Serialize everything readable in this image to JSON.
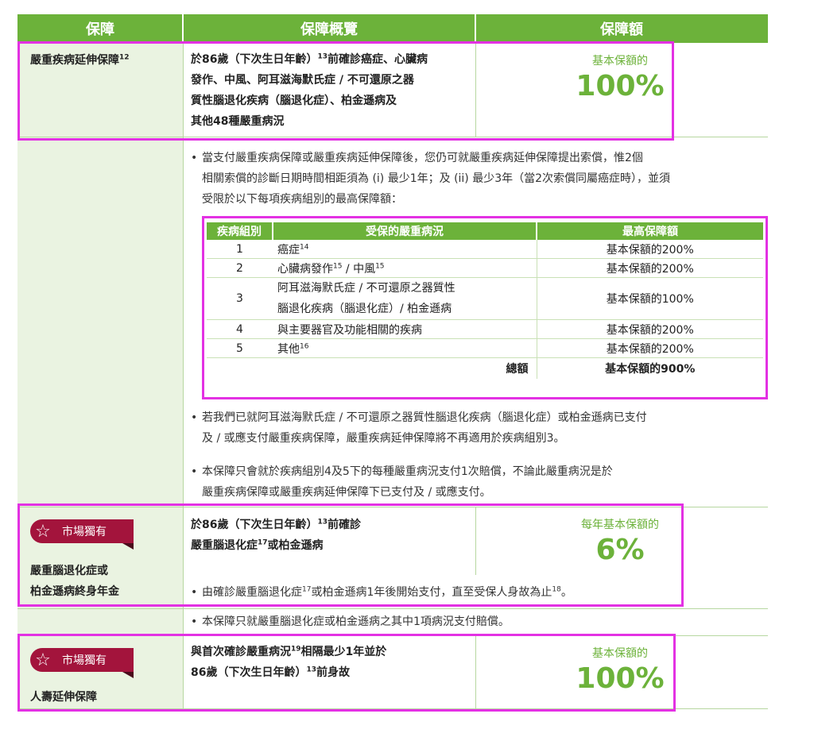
{
  "header": {
    "col1": "保障",
    "col2": "保障概覽",
    "col3": "保障額"
  },
  "row1": {
    "name": "嚴重疾病延伸保障",
    "name_sup": "12",
    "desc_lines": [
      {
        "pre": "於86歲（下次生日年齡）",
        "sup": "13",
        "post": "前確診癌症、心臟病"
      },
      {
        "pre": "發作、中風、阿耳滋海默氏症 / 不可還原之器",
        "sup": "",
        "post": ""
      },
      {
        "pre": "質性腦退化疾病（腦退化症）、柏金遜病及",
        "sup": "",
        "post": ""
      },
      {
        "pre": "其他48種嚴重病況",
        "sup": "",
        "post": ""
      }
    ],
    "amount_label": "基本保額的",
    "amount_value": "100%"
  },
  "bullets1": {
    "b1": [
      "當支付嚴重疾病保障或嚴重疾病延伸保障後，您仍可就嚴重疾病延伸保障提出索償，惟2個",
      "相關索償的診斷日期時間相距須為 (i) 最少1年；及 (ii) 最少3年（當2次索償同屬癌症時），並須",
      "受限於以下每項疾病組別的最高保障額："
    ]
  },
  "inner_table": {
    "headers": [
      "疾病組別",
      "受保的嚴重病況",
      "最高保障額"
    ],
    "rows": [
      {
        "group": "1",
        "cond_lines": [
          {
            "t": "癌症",
            "s": "14"
          }
        ],
        "max": "基本保額的200%"
      },
      {
        "group": "2",
        "cond_lines": [
          {
            "t": "心臟病發作",
            "s": "15"
          },
          {
            "t": " / 中風",
            "s": "15"
          }
        ],
        "max": "基本保額的200%"
      },
      {
        "group": "3",
        "cond_lines": [
          {
            "t": "阿耳滋海默氏症 / 不可還原之器質性",
            "s": ""
          }
        ],
        "cond2": "腦退化疾病（腦退化症）/ 柏金遜病",
        "max": "基本保額的100%"
      },
      {
        "group": "4",
        "cond_lines": [
          {
            "t": "與主要器官及功能相關的疾病",
            "s": ""
          }
        ],
        "max": "基本保額的200%"
      },
      {
        "group": "5",
        "cond_lines": [
          {
            "t": "其他",
            "s": "16"
          }
        ],
        "max": "基本保額的200%"
      }
    ],
    "total_label": "總額",
    "total_value": "基本保額的900%"
  },
  "bullets2": {
    "b2": [
      "若我們已就阿耳滋海默氏症 / 不可還原之器質性腦退化疾病（腦退化症）或柏金遜病已支付",
      "及 / 或應支付嚴重疾病保障，嚴重疾病延伸保障將不再適用於疾病組別3。"
    ],
    "b3": [
      "本保障只會就於疾病組別4及5下的每種嚴重病況支付1次賠償，不論此嚴重病況是於",
      "嚴重疾病保障或嚴重疾病延伸保障下已支付及 / 或應支付。"
    ]
  },
  "row2": {
    "badge": "市場獨有",
    "name_lines": [
      "嚴重腦退化症或",
      "柏金遜病終身年金"
    ],
    "desc_l1_pre": "於86歲（下次生日年齡）",
    "desc_l1_sup": "13",
    "desc_l1_post": "前確診",
    "desc_l2_pre": "嚴重腦退化症",
    "desc_l2_sup": "17",
    "desc_l2_post": "或柏金遜病",
    "amount_label": "每年基本保額的",
    "amount_value": "6%",
    "bullet_pre": "由確診嚴重腦退化症",
    "bullet_sup1": "17",
    "bullet_mid": "或柏金遜病1年後開始支付，直至受保人身故為止",
    "bullet_sup2": "18",
    "bullet_end": "。",
    "bullet_after": "本保障只就嚴重腦退化症或柏金遜病之其中1項病況支付賠償。"
  },
  "row3": {
    "badge": "市場獨有",
    "name": "人壽延伸保障",
    "desc_l1_pre": "與首次確診嚴重病況",
    "desc_l1_sup": "19",
    "desc_l1_post": "相隔最少1年並於",
    "desc_l2_pre": "86歲（下次生日年齡）",
    "desc_l2_sup": "13",
    "desc_l2_post": "前身故",
    "amount_label": "基本保額的",
    "amount_value": "100%"
  },
  "colors": {
    "green": "#6cb23a",
    "light_green": "#eaf3e1",
    "badge": "#a3143c",
    "highlight": "#e331e3"
  },
  "icons": {
    "badge_icon": "star-icon"
  }
}
